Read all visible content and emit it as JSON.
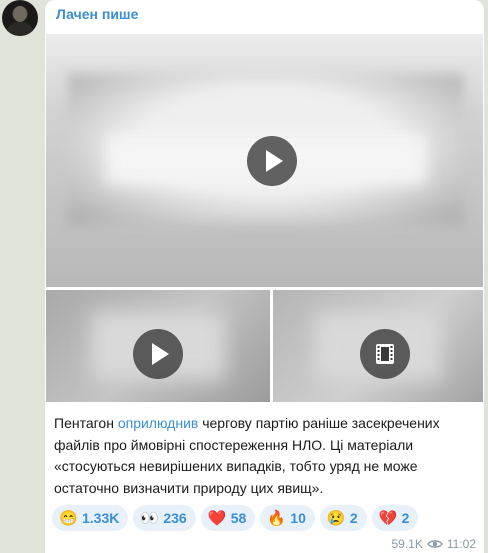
{
  "post": {
    "sender": "Лачен пише",
    "caption": {
      "before": "Пентагон ",
      "link": "оприлюднив",
      "after": " чергову партію раніше засекречених файлів про ймовірні спостереження НЛО. Ці матеріали «стосуються невирішених випадків, тобто уряд не може остаточно визначити природу цих явищ»."
    },
    "media": [
      {
        "type": "video",
        "icon": "play-icon"
      },
      {
        "type": "video",
        "icon": "play-icon"
      },
      {
        "type": "video",
        "icon": "film-icon"
      }
    ],
    "reactions": [
      {
        "emoji": "😁",
        "icon": "grin-emoji",
        "count": "1.33K"
      },
      {
        "emoji": "👀",
        "icon": "eyes-emoji",
        "count": "236"
      },
      {
        "emoji": "❤️",
        "icon": "heart-emoji",
        "count": "58"
      },
      {
        "emoji": "🔥",
        "icon": "fire-emoji",
        "count": "10"
      },
      {
        "emoji": "😢",
        "icon": "crying-emoji",
        "count": "2"
      },
      {
        "emoji": "💔",
        "icon": "broken-heart-emoji",
        "count": "2"
      }
    ],
    "views": "59.1K",
    "time": "11:02"
  },
  "colors": {
    "accent": "#3a8fd3",
    "background": "#dfe3da",
    "reaction_bg": "#e8f1f9",
    "meta": "#8a9aa6"
  }
}
